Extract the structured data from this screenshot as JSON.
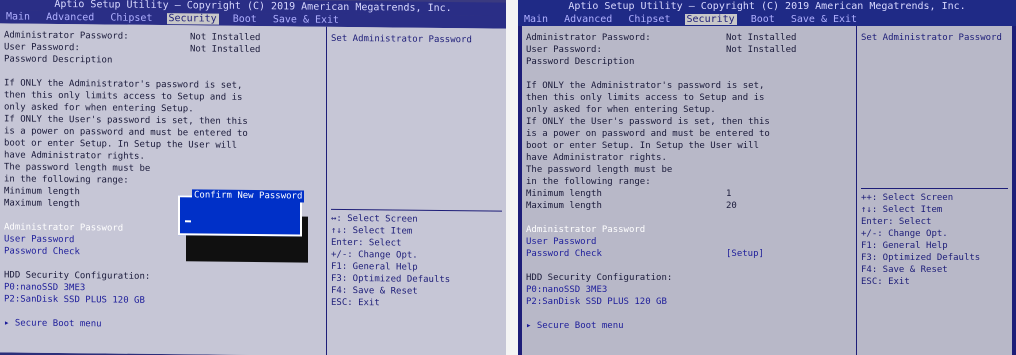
{
  "bios": {
    "title": "Aptio Setup Utility – Copyright (C) 2019 American Megatrends, Inc.",
    "menu": [
      "Main",
      "Advanced",
      "Chipset",
      "Security",
      "Boot",
      "Save & Exit"
    ],
    "active_menu": "Security",
    "passwords": {
      "admin_label": "Administrator Password:",
      "admin_value": "Not Installed",
      "user_label": "User Password:",
      "user_value": "Not Installed",
      "description_label": "Password Description"
    },
    "description_lines": [
      "If ONLY the Administrator's password is set,",
      "then this only limits access to Setup and is",
      "only asked for when entering Setup.",
      "If ONLY the User's password is set, then this",
      "is a power on password and must be entered to",
      "boot or enter Setup. In Setup the User will",
      "have Administrator rights.",
      "The password length must be",
      "in the following range:"
    ],
    "min_length_label": "Minimum length",
    "min_length_value": "1",
    "max_length_label": "Maximum length",
    "max_length_value": "20",
    "admin_password_link": "Administrator Password",
    "user_password_link": "User Password",
    "password_check_label": "Password Check",
    "password_check_value": "[Setup]",
    "hdd_security_label": "HDD Security Configuration:",
    "hdd_items": [
      "P0:nanoSSD 3ME3",
      "P2:SanDisk SSD PLUS 120 GB"
    ],
    "secure_boot_link": "Secure Boot menu",
    "help_text": "Set Administrator Password",
    "key_help": [
      "++: Select Screen",
      "↑↓: Select Item",
      "Enter: Select",
      "+/-: Change Opt.",
      "F1: General Help",
      "F3: Optimized Defaults",
      "F4: Save & Reset",
      "ESC: Exit"
    ],
    "left_key_help_0": "↔: Select Screen",
    "left_secure_boot": "Secure Boot menu",
    "dialog_title": "Confirm New Password"
  }
}
